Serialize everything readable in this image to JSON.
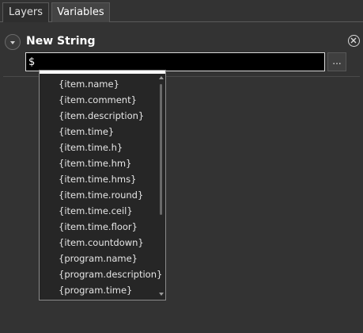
{
  "tabs": [
    {
      "label": "Layers",
      "active": false
    },
    {
      "label": "Variables",
      "active": true
    }
  ],
  "variable": {
    "name": "New String",
    "value": "$",
    "browse_label": "..."
  },
  "dropdown": {
    "items": [
      "{item.name}",
      "{item.comment}",
      "{item.description}",
      "{item.time}",
      "{item.time.h}",
      "{item.time.hm}",
      "{item.time.hms}",
      "{item.time.round}",
      "{item.time.ceil}",
      "{item.time.floor}",
      "{item.countdown}",
      "{program.name}",
      "{program.description}",
      "{program.time}"
    ]
  },
  "icons": {
    "expand": "chevron-down-icon",
    "close": "close-circle-icon",
    "scroll_up": "arrow-up-icon",
    "scroll_down": "arrow-down-icon"
  },
  "colors": {
    "background": "#333333",
    "input_background": "#000000",
    "dropdown_background": "#262626",
    "text": "#e6e6e6"
  }
}
